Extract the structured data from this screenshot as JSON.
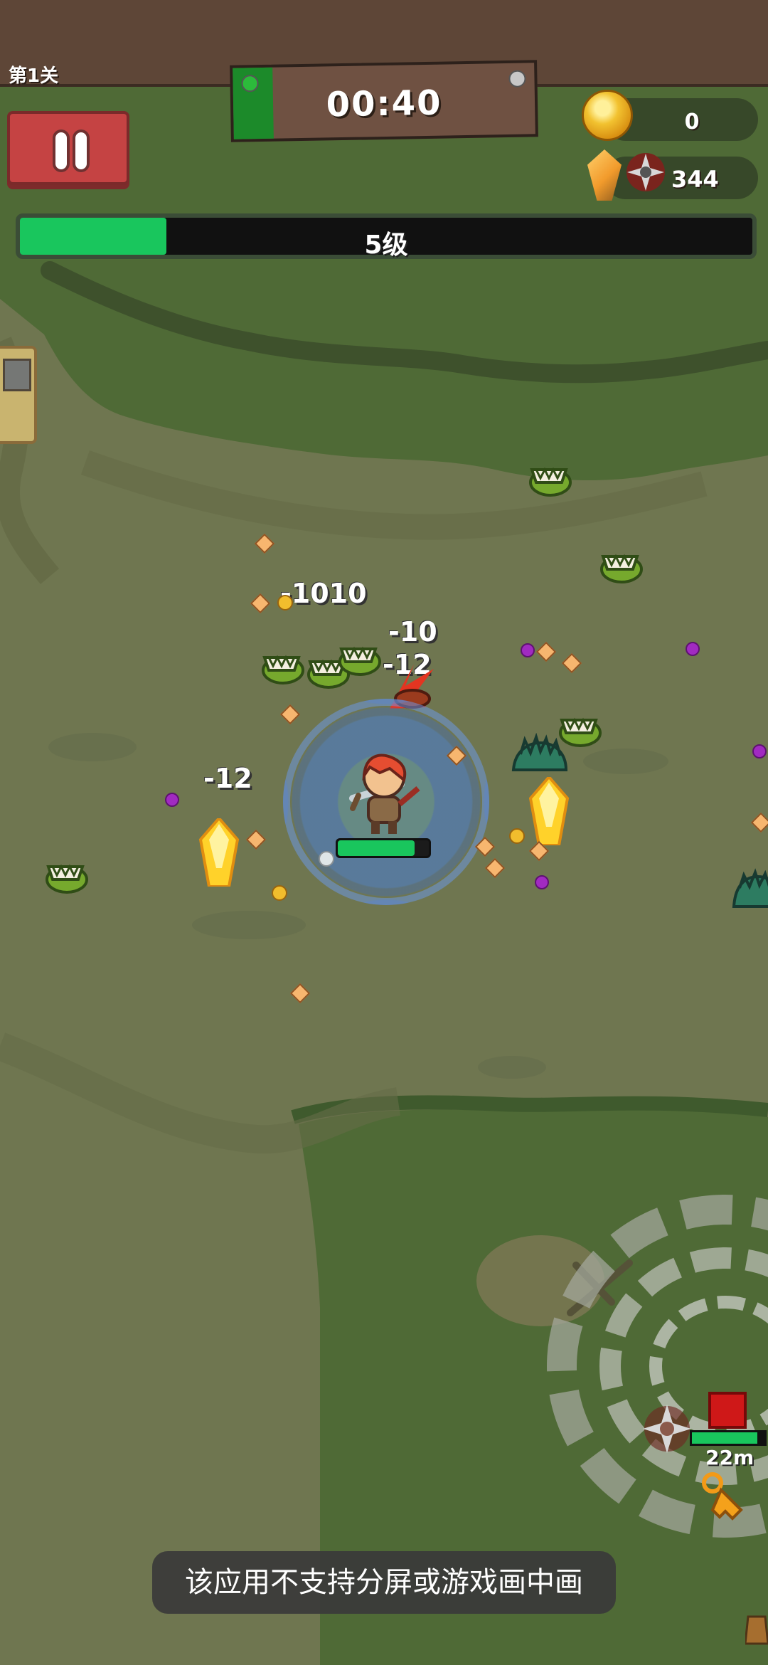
{
  "hud": {
    "stage": "第1关",
    "timer": "00:40",
    "coins": "0",
    "gems": "344",
    "level_label": "5级",
    "level_progress": 0.2,
    "player_hp": 0.84
  },
  "damage_numbers": [
    "-1010",
    "-10",
    "-12",
    "-12"
  ],
  "radar": {
    "distance": "22m",
    "distance_progress": 0.9
  },
  "toast": {
    "message": "该应用不支持分屏或游戏画中画"
  },
  "colors": {
    "ground": "#6f7650",
    "grass": "#4f6a36",
    "hud_green": "#19c65d",
    "pause_red": "#c54343",
    "timer_wood": "#6f5142"
  },
  "icons": {
    "pause": "pause-icon",
    "coin": "coin-icon",
    "gems": "crystal-icon",
    "shuriken": "shuriken-icon",
    "boss": "boss-marker-icon"
  }
}
